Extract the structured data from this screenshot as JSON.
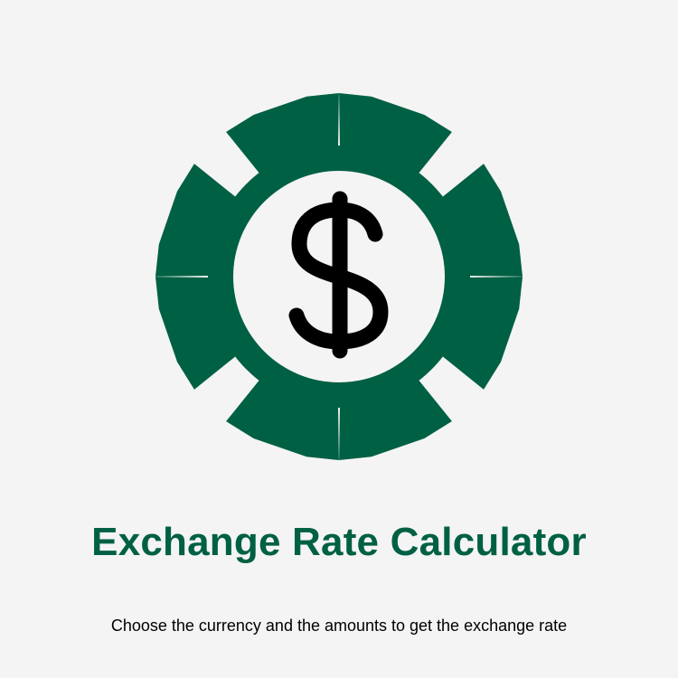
{
  "app": {
    "logo_icon": "gear-with-dollar-icon",
    "title": "Exchange Rate Calculator",
    "subtitle": "Choose the currency and the amounts to get the exchange rate"
  },
  "colors": {
    "accent": "#006044",
    "background": "#f4f4f4",
    "icon_inner": "#000000"
  }
}
